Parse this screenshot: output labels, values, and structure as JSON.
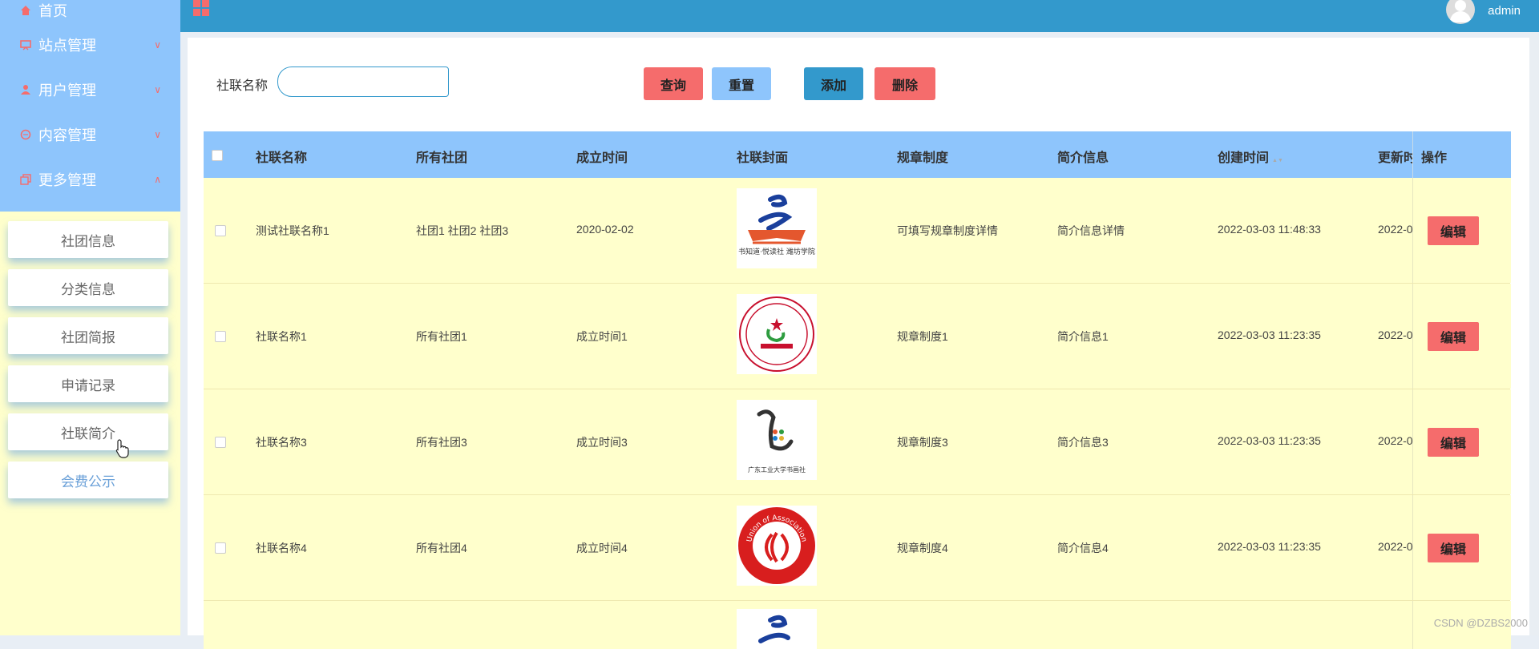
{
  "sidebar": {
    "menu": [
      {
        "label": "首页",
        "icon": "home-icon",
        "arrow": ""
      },
      {
        "label": "站点管理",
        "icon": "monitor-icon",
        "arrow": "∨"
      },
      {
        "label": "用户管理",
        "icon": "user-icon",
        "arrow": "∨"
      },
      {
        "label": "内容管理",
        "icon": "chat-icon",
        "arrow": "∨"
      },
      {
        "label": "更多管理",
        "icon": "copy-icon",
        "arrow": "∧"
      }
    ],
    "submenu": [
      "社团信息",
      "分类信息",
      "社团简报",
      "申请记录",
      "社联简介",
      "会费公示"
    ]
  },
  "topbar": {
    "username": "admin"
  },
  "search": {
    "label": "社联名称",
    "value": "",
    "placeholder": ""
  },
  "buttons": {
    "query": "查询",
    "reset": "重置",
    "add": "添加",
    "delete": "删除"
  },
  "table": {
    "headers": [
      "社联名称",
      "所有社团",
      "成立时间",
      "社联封面",
      "规章制度",
      "简介信息",
      "创建时间",
      "更新时",
      "操作"
    ],
    "sort_indicator": "▲▼",
    "rows": [
      {
        "name": "测试社联名称1",
        "clubs": "社团1 社团2 社团3",
        "founded": "2020-02-02",
        "cover": "书知道·悦读社 潍坊学院",
        "rules": "可填写规章制度详情",
        "intro": "简介信息详情",
        "created": "2022-03-03 11:48:33",
        "updated": "2022-0",
        "edit": "编辑"
      },
      {
        "name": "社联名称1",
        "clubs": "所有社团1",
        "founded": "成立时间1",
        "cover": "",
        "rules": "规章制度1",
        "intro": "简介信息1",
        "created": "2022-03-03 11:23:35",
        "updated": "2022-0",
        "edit": "编辑"
      },
      {
        "name": "社联名称3",
        "clubs": "所有社团3",
        "founded": "成立时间3",
        "cover": "广东工业大学书画社",
        "rules": "规章制度3",
        "intro": "简介信息3",
        "created": "2022-03-03 11:23:35",
        "updated": "2022-0",
        "edit": "编辑"
      },
      {
        "name": "社联名称4",
        "clubs": "所有社团4",
        "founded": "成立时间4",
        "cover": "Union of Association",
        "rules": "规章制度4",
        "intro": "简介信息4",
        "created": "2022-03-03 11:23:35",
        "updated": "2022-0",
        "edit": "编辑"
      }
    ]
  },
  "watermark": "CSDN @DZBS2000",
  "colors": {
    "sidebar_top": "#8ec5fc",
    "sidebar_bg": "#ffffcc",
    "topbar": "#3399cc",
    "accent_red": "#f56c6c",
    "row_bg": "#ffffcc"
  }
}
